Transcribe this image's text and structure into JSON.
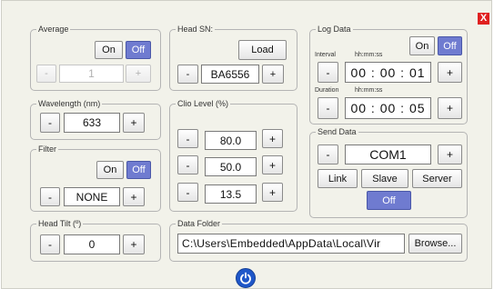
{
  "close": {
    "label": "X"
  },
  "average": {
    "title": "Average",
    "on_label": "On",
    "off_label": "Off",
    "minus": "-",
    "value": "1",
    "plus": "+"
  },
  "head_sn": {
    "title": "Head SN:",
    "load_label": "Load",
    "minus": "-",
    "value": "BA6556",
    "plus": "+"
  },
  "log_data": {
    "title": "Log Data",
    "on_label": "On",
    "off_label": "Off",
    "interval_label": "Interval",
    "interval_format": "hh:mm:ss",
    "interval_value": "00 : 00 : 01",
    "duration_label": "Duration",
    "duration_format": "hh:mm:ss",
    "duration_value": "00 : 00 : 05",
    "minus": "-",
    "plus": "+"
  },
  "wavelength": {
    "title": "Wavelength (nm)",
    "minus": "-",
    "value": "633",
    "plus": "+"
  },
  "clio_level": {
    "title": "Clio Level (%)",
    "minus": "-",
    "plus": "+",
    "values": [
      "80.0",
      "50.0",
      "13.5"
    ]
  },
  "send_data": {
    "title": "Send Data",
    "minus": "-",
    "port": "COM1",
    "plus": "+",
    "link_label": "Link",
    "slave_label": "Slave",
    "server_label": "Server",
    "off_label": "Off"
  },
  "filter": {
    "title": "Filter",
    "on_label": "On",
    "off_label": "Off",
    "minus": "-",
    "value": "NONE",
    "plus": "+"
  },
  "head_tilt": {
    "title": "Head Tilt (º)",
    "minus": "-",
    "value": "0",
    "plus": "+"
  },
  "data_folder": {
    "title": "Data Folder",
    "path": "C:\\Users\\Embedded\\AppData\\Local\\Vir",
    "browse_label": "Browse..."
  },
  "colors": {
    "selected": "#6f7bd0",
    "panel_bg": "#f2f2ea",
    "close_red": "#e02020",
    "power_blue": "#1f57c9"
  },
  "icons": {
    "close": "close-icon",
    "power": "power-icon"
  }
}
